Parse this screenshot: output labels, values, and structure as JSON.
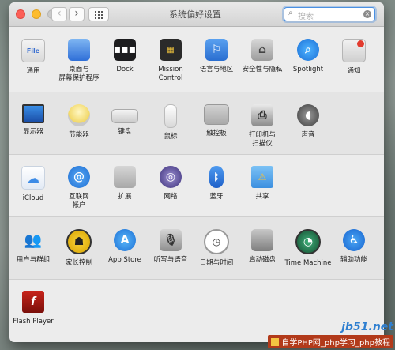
{
  "window": {
    "title": "系统偏好设置"
  },
  "search": {
    "placeholder": "搜索"
  },
  "sections": [
    {
      "items": [
        {
          "label": "通用",
          "icon": "general-icon"
        },
        {
          "label": "桌面与\n屏幕保护程序",
          "icon": "desktop-screensaver-icon"
        },
        {
          "label": "Dock",
          "icon": "dock-icon"
        },
        {
          "label": "Mission\nControl",
          "icon": "mission-control-icon"
        },
        {
          "label": "语言与地区",
          "icon": "language-region-icon"
        },
        {
          "label": "安全性与隐私",
          "icon": "security-privacy-icon"
        },
        {
          "label": "Spotlight",
          "icon": "spotlight-icon"
        },
        {
          "label": "通知",
          "icon": "notifications-icon"
        }
      ]
    },
    {
      "items": [
        {
          "label": "显示器",
          "icon": "displays-icon"
        },
        {
          "label": "节能器",
          "icon": "energy-saver-icon"
        },
        {
          "label": "键盘",
          "icon": "keyboard-icon"
        },
        {
          "label": "鼠标",
          "icon": "mouse-icon"
        },
        {
          "label": "触控板",
          "icon": "trackpad-icon"
        },
        {
          "label": "打印机与\n扫描仪",
          "icon": "printers-scanners-icon"
        },
        {
          "label": "声音",
          "icon": "sound-icon"
        }
      ]
    },
    {
      "items": [
        {
          "label": "iCloud",
          "icon": "icloud-icon"
        },
        {
          "label": "互联网\n帐户",
          "icon": "internet-accounts-icon"
        },
        {
          "label": "扩展",
          "icon": "extensions-icon"
        },
        {
          "label": "网络",
          "icon": "network-icon"
        },
        {
          "label": "蓝牙",
          "icon": "bluetooth-icon"
        },
        {
          "label": "共享",
          "icon": "sharing-icon"
        }
      ]
    },
    {
      "items": [
        {
          "label": "用户与群组",
          "icon": "users-groups-icon"
        },
        {
          "label": "家长控制",
          "icon": "parental-controls-icon"
        },
        {
          "label": "App Store",
          "icon": "app-store-icon"
        },
        {
          "label": "听写与语音",
          "icon": "dictation-speech-icon"
        },
        {
          "label": "日期与时间",
          "icon": "date-time-icon"
        },
        {
          "label": "启动磁盘",
          "icon": "startup-disk-icon"
        },
        {
          "label": "Time Machine",
          "icon": "time-machine-icon"
        },
        {
          "label": "辅助功能",
          "icon": "accessibility-icon"
        }
      ]
    },
    {
      "items": [
        {
          "label": "Flash Player",
          "icon": "flash-player-icon"
        }
      ]
    }
  ],
  "watermark": {
    "site": "jb51.net",
    "bar": "自学PHP网_php学习_php教程"
  }
}
